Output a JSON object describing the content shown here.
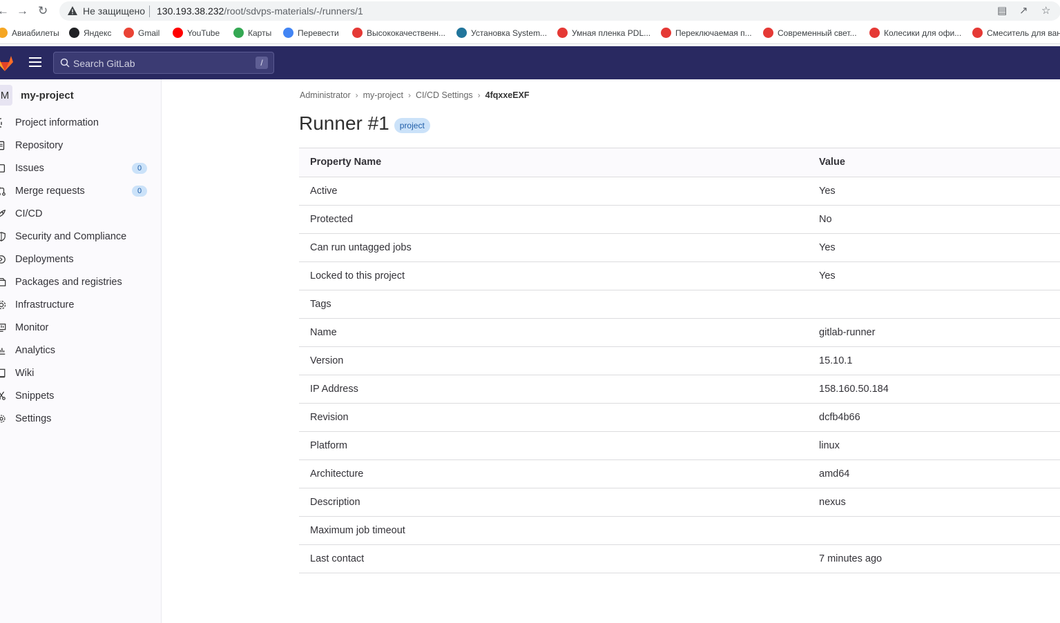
{
  "browser": {
    "security_label": "Не защищено",
    "url_host": "130.193.38.232",
    "url_path": "/root/sdvps-materials/-/runners/1"
  },
  "bookmarks": [
    {
      "label": "Авиабилеты",
      "color": "#f5a623"
    },
    {
      "label": "Яндекс",
      "color": "#202124"
    },
    {
      "label": "Gmail",
      "color": "#ea4335"
    },
    {
      "label": "YouTube",
      "color": "#ff0000"
    },
    {
      "label": "Карты",
      "color": "#34a853"
    },
    {
      "label": "Перевести",
      "color": "#4285f4"
    },
    {
      "label": "Высококачественн...",
      "color": "#e53935"
    },
    {
      "label": "Установка System...",
      "color": "#21759b"
    },
    {
      "label": "Умная пленка PDL...",
      "color": "#e53935"
    },
    {
      "label": "Переключаемая п...",
      "color": "#e53935"
    },
    {
      "label": "Современный свет...",
      "color": "#e53935"
    },
    {
      "label": "Колесики для офи...",
      "color": "#e53935"
    },
    {
      "label": "Смеситель для ван",
      "color": "#e53935"
    }
  ],
  "header": {
    "search_placeholder": "Search GitLab",
    "search_shortcut": "/"
  },
  "sidebar": {
    "project_avatar": "M",
    "project_name": "my-project",
    "items": [
      {
        "label": "Project information",
        "icon": "info-icon"
      },
      {
        "label": "Repository",
        "icon": "doc-icon"
      },
      {
        "label": "Issues",
        "icon": "issues-icon",
        "badge": "0"
      },
      {
        "label": "Merge requests",
        "icon": "merge-icon",
        "badge": "0"
      },
      {
        "label": "CI/CD",
        "icon": "rocket-icon"
      },
      {
        "label": "Security and Compliance",
        "icon": "shield-icon"
      },
      {
        "label": "Deployments",
        "icon": "deploy-icon"
      },
      {
        "label": "Packages and registries",
        "icon": "package-icon"
      },
      {
        "label": "Infrastructure",
        "icon": "cloud-icon"
      },
      {
        "label": "Monitor",
        "icon": "monitor-icon"
      },
      {
        "label": "Analytics",
        "icon": "chart-icon"
      },
      {
        "label": "Wiki",
        "icon": "book-icon"
      },
      {
        "label": "Snippets",
        "icon": "scissors-icon"
      },
      {
        "label": "Settings",
        "icon": "gear-icon"
      }
    ]
  },
  "breadcrumb": [
    "Administrator",
    "my-project",
    "CI/CD Settings",
    "4fqxxeEXF"
  ],
  "page": {
    "title": "Runner #1",
    "pill": "project"
  },
  "table": {
    "headers": [
      "Property Name",
      "Value"
    ],
    "rows": [
      [
        "Active",
        "Yes"
      ],
      [
        "Protected",
        "No"
      ],
      [
        "Can run untagged jobs",
        "Yes"
      ],
      [
        "Locked to this project",
        "Yes"
      ],
      [
        "Tags",
        ""
      ],
      [
        "Name",
        "gitlab-runner"
      ],
      [
        "Version",
        "15.10.1"
      ],
      [
        "IP Address",
        "158.160.50.184"
      ],
      [
        "Revision",
        "dcfb4b66"
      ],
      [
        "Platform",
        "linux"
      ],
      [
        "Architecture",
        "amd64"
      ],
      [
        "Description",
        "nexus"
      ],
      [
        "Maximum job timeout",
        ""
      ],
      [
        "Last contact",
        "7 minutes ago"
      ]
    ]
  }
}
